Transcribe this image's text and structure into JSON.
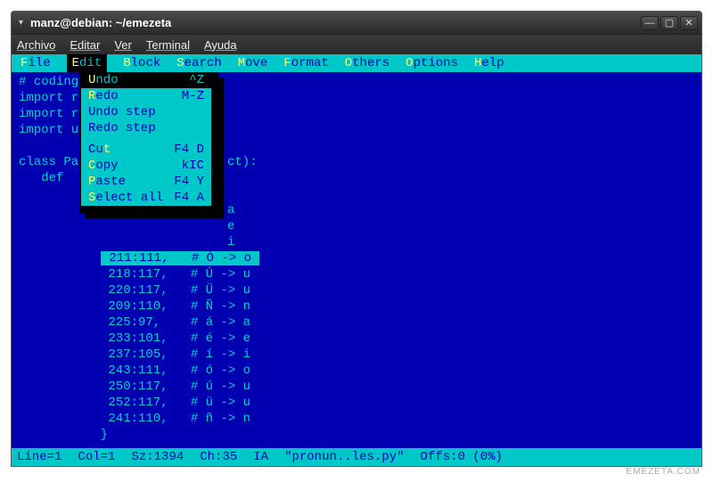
{
  "window": {
    "title": "manz@debian: ~/emezeta"
  },
  "os_menu": {
    "items": [
      "Archivo",
      "Editar",
      "Ver",
      "Terminal",
      "Ayuda"
    ]
  },
  "editor_menu": {
    "items": [
      {
        "hot": "F",
        "rest": "ile"
      },
      {
        "hot": "E",
        "rest": "dit",
        "active": true
      },
      {
        "hot": "B",
        "rest": "lock"
      },
      {
        "hot": "S",
        "rest": "earch"
      },
      {
        "hot": "M",
        "rest": "ove"
      },
      {
        "hot": "F",
        "rest": "ormat"
      },
      {
        "hot": "O",
        "rest": "thers"
      },
      {
        "hot": "O",
        "rest": "ptions"
      },
      {
        "hot": "H",
        "rest": "elp"
      }
    ]
  },
  "dropdown": {
    "items": [
      {
        "hot": "U",
        "rest": "ndo",
        "shortcut": "^Z",
        "selected": true
      },
      {
        "hot": "R",
        "rest": "edo",
        "shortcut": "M-Z"
      },
      {
        "hot": "",
        "rest": "Undo step",
        "shortcut": ""
      },
      {
        "hot": "",
        "rest": "Redo step",
        "shortcut": ""
      },
      {
        "sep": true
      },
      {
        "hot": "",
        "rest": "Cu",
        "hot2": "t",
        "shortcut": "F4 D"
      },
      {
        "hot": "C",
        "rest": "opy",
        "shortcut": "kIC"
      },
      {
        "hot": "P",
        "rest": "aste",
        "shortcut": "F4 Y"
      },
      {
        "hot": "S",
        "rest": "elect all",
        "shortcut": "F4 A"
      }
    ]
  },
  "code": {
    "pre_lines": [
      "# coding",
      "import r",
      "import r",
      "import u",
      "",
      "class Pa",
      "   def"
    ],
    "partial_suffix": "ct):",
    "partial_letters": [
      "a",
      "e",
      "i"
    ],
    "rows": [
      {
        "k": "211",
        "v": "111",
        "c": "# Ó -> o",
        "hl": true
      },
      {
        "k": "218",
        "v": "117",
        "c": "# Ú -> u"
      },
      {
        "k": "220",
        "v": "117",
        "c": "# Ü -> u"
      },
      {
        "k": "209",
        "v": "110",
        "c": "# Ñ -> n"
      },
      {
        "k": "225",
        "v": "97",
        "c": "# á -> a"
      },
      {
        "k": "233",
        "v": "101",
        "c": "# é -> e"
      },
      {
        "k": "237",
        "v": "105",
        "c": "# í -> i"
      },
      {
        "k": "243",
        "v": "111",
        "c": "# ó -> o"
      },
      {
        "k": "250",
        "v": "117",
        "c": "# ú -> u"
      },
      {
        "k": "252",
        "v": "117",
        "c": "# ü -> u"
      },
      {
        "k": "241",
        "v": "110",
        "c": "# ñ -> n"
      }
    ],
    "close_brace": "         }"
  },
  "status": {
    "line": "Line=1",
    "col": "Col=1",
    "sz": "Sz:1394",
    "ch": "Ch:35",
    "ia": "IA",
    "file": "\"pronun..les.py\"",
    "offs": "Offs:0 (0%)"
  },
  "watermark": "EMEZETA.COM"
}
